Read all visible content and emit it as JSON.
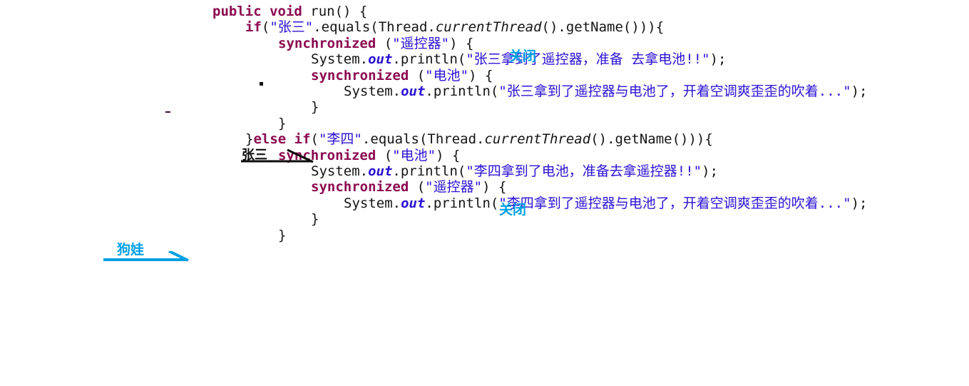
{
  "view": {
    "kind": "code-snippet-with-annotations",
    "background": "#ffffff",
    "language": "Java"
  },
  "colors": {
    "keyword": "#8b0a50",
    "string": "#2a12d4",
    "plain": "#141414",
    "field": "#2a12d4",
    "annotation_cyan": "#00a0e4",
    "annotation_black": "#0d0d0d"
  },
  "code": {
    "lines": [
      {
        "id": "line-1",
        "indent": 0,
        "text": "public void run() {",
        "tokens": [
          {
            "t": "public void ",
            "c": "kw"
          },
          {
            "t": "run() {",
            "c": "plain"
          }
        ]
      },
      {
        "id": "line-2",
        "indent": 1,
        "text": "if(\"张三\".equals(Thread.currentThread().getName())){",
        "tokens": [
          {
            "t": "if",
            "c": "kw"
          },
          {
            "t": "(",
            "c": "plain"
          },
          {
            "t": "\"张三\"",
            "c": "str"
          },
          {
            "t": ".equals(Thread.",
            "c": "plain"
          },
          {
            "t": "currentThread",
            "c": "ital"
          },
          {
            "t": "().getName())){",
            "c": "plain"
          }
        ]
      },
      {
        "id": "line-3",
        "indent": 2,
        "text": "synchronized (\"遥控器\") {",
        "tokens": [
          {
            "t": "synchronized",
            "c": "kw"
          },
          {
            "t": " (",
            "c": "plain"
          },
          {
            "t": "\"遥控器\"",
            "c": "str"
          },
          {
            "t": ") {",
            "c": "plain"
          }
        ]
      },
      {
        "id": "line-4",
        "indent": 3,
        "text": "System.out.println(\"张三拿到了遥控器，准备 去拿电池!!\");",
        "tokens": [
          {
            "t": "System.",
            "c": "plain"
          },
          {
            "t": "out",
            "c": "fld"
          },
          {
            "t": ".println(",
            "c": "plain"
          },
          {
            "t": "\"张三拿到了遥控器，准备 去拿电池!!\"",
            "c": "str"
          },
          {
            "t": ");",
            "c": "plain"
          }
        ]
      },
      {
        "id": "line-5",
        "indent": 3,
        "text": "synchronized (\"电池\") {",
        "tokens": [
          {
            "t": "synchronized",
            "c": "kw"
          },
          {
            "t": " (",
            "c": "plain"
          },
          {
            "t": "\"电池\"",
            "c": "str"
          },
          {
            "t": ") {",
            "c": "plain"
          }
        ]
      },
      {
        "id": "line-6",
        "indent": 4,
        "text": "System.out.println(\"张三拿到了遥控器与电池了，开着空调爽歪歪的吹着...\");",
        "tokens": [
          {
            "t": "System.",
            "c": "plain"
          },
          {
            "t": "out",
            "c": "fld"
          },
          {
            "t": ".println(",
            "c": "plain"
          },
          {
            "t": "\"张三拿到了遥控器与电池了，开着空调爽歪歪的吹着...\"",
            "c": "str"
          },
          {
            "t": ");",
            "c": "plain"
          }
        ]
      },
      {
        "id": "line-7",
        "indent": 3,
        "text": "}",
        "tokens": [
          {
            "t": "}",
            "c": "plain"
          }
        ]
      },
      {
        "id": "line-8",
        "indent": 2,
        "text": "}",
        "tokens": [
          {
            "t": "}",
            "c": "plain"
          }
        ]
      },
      {
        "id": "line-9",
        "indent": 1,
        "text": "}else if(\"李四\".equals(Thread.currentThread().getName())){",
        "tokens": [
          {
            "t": "}",
            "c": "plain"
          },
          {
            "t": "else if",
            "c": "kw"
          },
          {
            "t": "(",
            "c": "plain"
          },
          {
            "t": "\"李四\"",
            "c": "str"
          },
          {
            "t": ".equals(Thread.",
            "c": "plain"
          },
          {
            "t": "currentThread",
            "c": "ital"
          },
          {
            "t": "().getName())){",
            "c": "plain"
          }
        ]
      },
      {
        "id": "line-10",
        "indent": 2,
        "text": "synchronized (\"电池\") {",
        "tokens": [
          {
            "t": "synchronized",
            "c": "kw"
          },
          {
            "t": " (",
            "c": "plain"
          },
          {
            "t": "\"电池\"",
            "c": "str"
          },
          {
            "t": ") {",
            "c": "plain"
          }
        ]
      },
      {
        "id": "line-11",
        "indent": 3,
        "text": "System.out.println(\"李四拿到了电池，准备去拿遥控器!!\");",
        "tokens": [
          {
            "t": "System.",
            "c": "plain"
          },
          {
            "t": "out",
            "c": "fld"
          },
          {
            "t": ".println(",
            "c": "plain"
          },
          {
            "t": "\"李四拿到了电池，准备去拿遥控器!!\"",
            "c": "str"
          },
          {
            "t": ");",
            "c": "plain"
          }
        ]
      },
      {
        "id": "line-12",
        "indent": 3,
        "text": "synchronized (\"遥控器\") {",
        "tokens": [
          {
            "t": "synchronized",
            "c": "kw"
          },
          {
            "t": " (",
            "c": "plain"
          },
          {
            "t": "\"遥控器\"",
            "c": "str"
          },
          {
            "t": ") {",
            "c": "plain"
          }
        ]
      },
      {
        "id": "line-13",
        "indent": 4,
        "text": "System.out.println(\"李四拿到了遥控器与电池了，开着空调爽歪歪的吹着...\");",
        "tokens": [
          {
            "t": "System.",
            "c": "plain"
          },
          {
            "t": "out",
            "c": "fld"
          },
          {
            "t": ".println(",
            "c": "plain"
          },
          {
            "t": "\"李四拿到了遥控器与电池了，开着空调爽歪歪的吹着...\"",
            "c": "str"
          },
          {
            "t": ");",
            "c": "plain"
          }
        ]
      },
      {
        "id": "line-14",
        "indent": 3,
        "text": "}",
        "tokens": [
          {
            "t": "}",
            "c": "plain"
          }
        ]
      },
      {
        "id": "line-15",
        "indent": 2,
        "text": "}",
        "tokens": [
          {
            "t": "}",
            "c": "plain"
          }
        ]
      }
    ]
  },
  "annotations": {
    "close_label_1": "关闭",
    "close_label_2": "关闭",
    "zhangsan_label": "张三",
    "gouwa_label": "狗娃"
  }
}
